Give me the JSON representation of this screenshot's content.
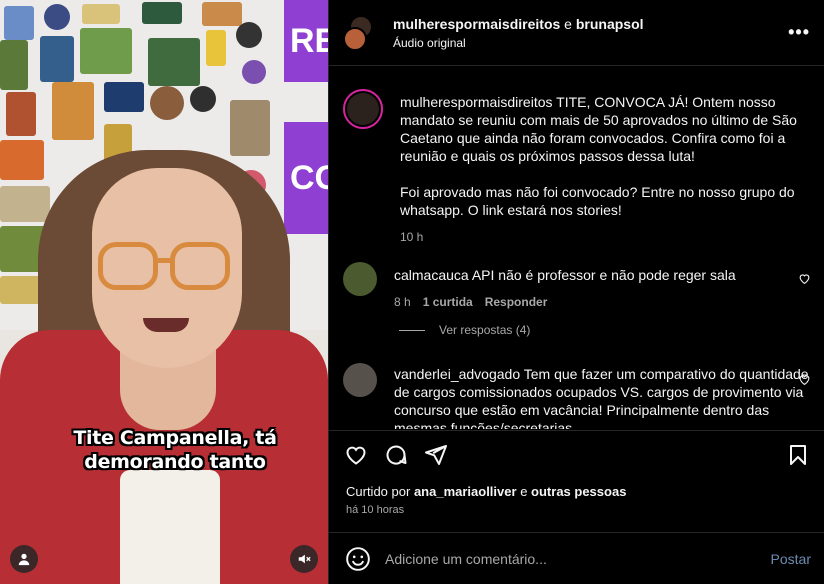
{
  "video": {
    "caption_line1": "Tite Campanella, tá",
    "caption_line2": "demorando tanto",
    "wall_sign_top": "RE",
    "wall_sign_mid": "CO"
  },
  "header": {
    "user1": "mulherespormaisdireitos",
    "joiner": "e",
    "user2": "brunapsol",
    "audio": "Áudio original",
    "more": "•••"
  },
  "post": {
    "username": "mulherespormaisdireitos",
    "text": "TITE, CONVOCA JÁ! Ontem nosso mandato se reuniu com mais de 50 aprovados no último de São Caetano que ainda não foram convocados. Confira como foi a reunião e quais os próximos passos dessa luta!\n\nFoi aprovado mas não foi convocado? Entre no nosso grupo do whatsapp. O link estará nos stories!",
    "time": "10 h"
  },
  "comments": [
    {
      "username": "calmacauca",
      "text": "API não é professor e não pode reger sala",
      "time": "8 h",
      "likes": "1 curtida",
      "reply": "Responder",
      "view_replies": "Ver respostas (4)"
    },
    {
      "username": "vanderlei_advogado",
      "text": "Tem que fazer um comparativo do quantidade de cargos comissionados ocupados VS. cargos de provimento via concurso que estão em vacância! Principalmente dentro das mesmas funções/secretarias"
    }
  ],
  "likes": {
    "prefix": "Curtido por",
    "user": "ana_mariaolliver",
    "joiner": "e",
    "others": "outras pessoas"
  },
  "posted": "há 10 horas",
  "add_comment": {
    "placeholder": "Adicione um comentário...",
    "post": "Postar"
  }
}
